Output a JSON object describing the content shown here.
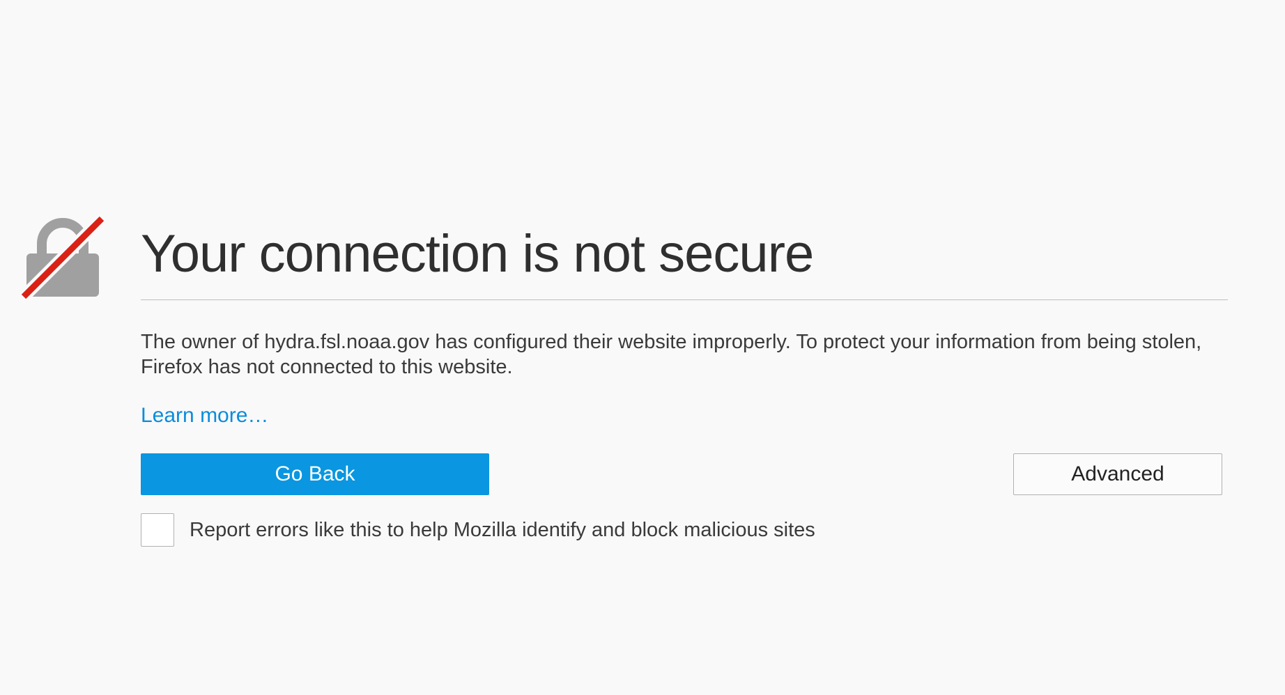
{
  "page": {
    "title": "Your connection is not secure",
    "description": "The owner of hydra.fsl.noaa.gov has configured their website improperly. To protect your information from being stolen, Firefox has not connected to this website.",
    "learn_more": "Learn more…",
    "go_back_label": "Go Back",
    "advanced_label": "Advanced",
    "report_label": "Report errors like this to help Mozilla identify and block malicious sites",
    "report_checked": false
  },
  "icons": {
    "lock": "broken-lock-icon"
  },
  "colors": {
    "background": "#f9f9fa",
    "primary_button": "#0a96e0",
    "link": "#0a8ddb",
    "lock_gray": "#a0a0a0",
    "strike_red": "#d92215"
  }
}
